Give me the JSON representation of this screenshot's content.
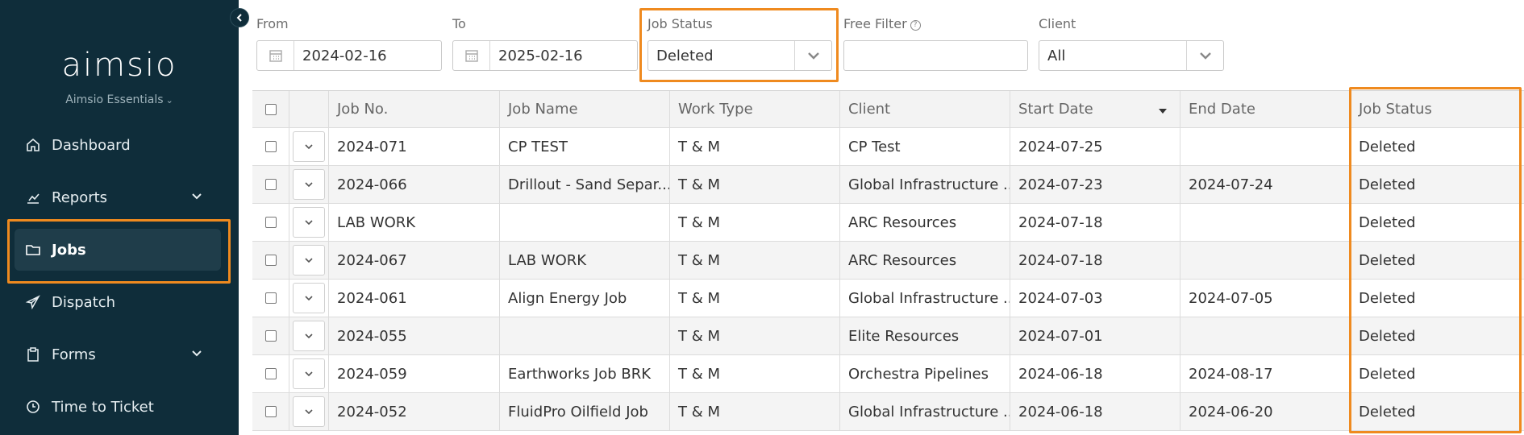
{
  "sidebar": {
    "logo": "aimsio",
    "org_name": "Aimsio Essentials",
    "items": [
      {
        "label": "Dashboard",
        "icon": "home-icon"
      },
      {
        "label": "Reports",
        "icon": "chart-icon"
      },
      {
        "label": "Jobs",
        "icon": "folder-icon"
      },
      {
        "label": "Dispatch",
        "icon": "send-icon"
      },
      {
        "label": "Forms",
        "icon": "clipboard-icon"
      },
      {
        "label": "Time to Ticket",
        "icon": "clock-icon"
      }
    ],
    "active": "Jobs"
  },
  "filters": {
    "from_label": "From",
    "from_value": "2024-02-16",
    "to_label": "To",
    "to_value": "2025-02-16",
    "status_label": "Job Status",
    "status_value": "Deleted",
    "free_filter_label": "Free Filter",
    "free_filter_value": "",
    "client_label": "Client",
    "client_value": "All"
  },
  "table": {
    "columns": [
      "Job No.",
      "Job Name",
      "Work Type",
      "Client",
      "Start Date",
      "End Date",
      "Job Status"
    ],
    "rows": [
      {
        "job_no": "2024-071",
        "job_name": "CP TEST",
        "work_type": "T & M",
        "client": "CP Test",
        "start": "2024-07-25",
        "end": "",
        "status": "Deleted"
      },
      {
        "job_no": "2024-066",
        "job_name": "Drillout - Sand Separ...",
        "work_type": "T & M",
        "client": "Global Infrastructure ...",
        "start": "2024-07-23",
        "end": "2024-07-24",
        "status": "Deleted"
      },
      {
        "job_no": "LAB WORK",
        "job_name": "",
        "work_type": "T & M",
        "client": "ARC Resources",
        "start": "2024-07-18",
        "end": "",
        "status": "Deleted"
      },
      {
        "job_no": "2024-067",
        "job_name": "LAB WORK",
        "work_type": "T & M",
        "client": "ARC Resources",
        "start": "2024-07-18",
        "end": "",
        "status": "Deleted"
      },
      {
        "job_no": "2024-061",
        "job_name": "Align Energy Job",
        "work_type": "T & M",
        "client": "Global Infrastructure ...",
        "start": "2024-07-03",
        "end": "2024-07-05",
        "status": "Deleted"
      },
      {
        "job_no": "2024-055",
        "job_name": "",
        "work_type": "T & M",
        "client": "Elite Resources",
        "start": "2024-07-01",
        "end": "",
        "status": "Deleted"
      },
      {
        "job_no": "2024-059",
        "job_name": "Earthworks Job BRK",
        "work_type": "T & M",
        "client": "Orchestra Pipelines",
        "start": "2024-06-18",
        "end": "2024-08-17",
        "status": "Deleted"
      },
      {
        "job_no": "2024-052",
        "job_name": "FluidPro Oilfield Job",
        "work_type": "T & M",
        "client": "Global Infrastructure ...",
        "start": "2024-06-18",
        "end": "2024-06-20",
        "status": "Deleted"
      }
    ]
  },
  "colors": {
    "sidebar_bg": "#0f2d3a",
    "highlight": "#ef8a1f"
  }
}
